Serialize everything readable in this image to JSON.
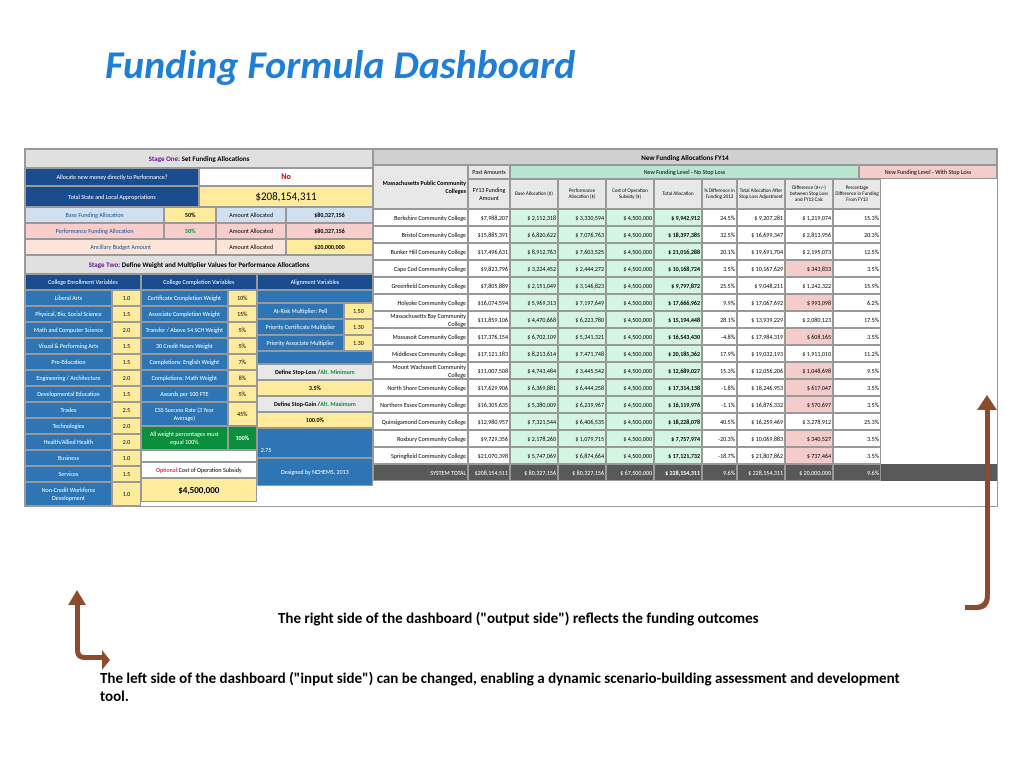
{
  "title": "Funding Formula Dashboard",
  "stage1_label": "Stage One:",
  "stage1_text": " Set Funding Allocations",
  "allocate_label": "Allocate new money directly to Performance?",
  "allocate_val": "No",
  "total_approp_label": "Total State and Local Appropriations",
  "total_approp_val": "$208,154,311",
  "base_fund_label": "Base Funding Allocation",
  "base_fund_pct": "50%",
  "amount_allocated_label": "Amount Allocated",
  "base_fund_amt": "$80,327,156",
  "perf_fund_label": "Performance Funding Allocation",
  "perf_fund_pct": "50%",
  "perf_fund_amt": "$80,327,156",
  "ancillary_label": "Ancillary Budget Amount",
  "ancillary_amt": "$20,000,000",
  "stage2_label": "Stage Two:",
  "stage2_text": " Define Weight and Multiplier Values for Performance Allocations",
  "col_enroll": "College Enrollment Variables",
  "col_complete": "College Completion Variables",
  "col_align": "Alignment Variables",
  "enroll_vars": [
    {
      "n": "Liberal Arts",
      "v": "1.0"
    },
    {
      "n": "Physical, Bio, Social Science",
      "v": "1.5"
    },
    {
      "n": "Math and Computer Science",
      "v": "2.0"
    },
    {
      "n": "Visual & Performing Arts",
      "v": "1.5"
    },
    {
      "n": "Pre-Education",
      "v": "1.5"
    },
    {
      "n": "Engineering / Architecture",
      "v": "2.0"
    },
    {
      "n": "Developmental Education",
      "v": "1.5"
    },
    {
      "n": "Trades",
      "v": "2.5"
    },
    {
      "n": "Technologies",
      "v": "2.0"
    },
    {
      "n": "Health/Allied Health",
      "v": "2.0"
    },
    {
      "n": "Business",
      "v": "1.0"
    },
    {
      "n": "Services",
      "v": "1.5"
    },
    {
      "n": "Non-Credit Workforce Development",
      "v": "1.0"
    }
  ],
  "complete_vars": [
    {
      "n": "Certificate Completion Weight",
      "v": "10%"
    },
    {
      "n": "Associate Completion Weight",
      "v": "15%"
    },
    {
      "n": "Transfer / Above 54 SCH Weight",
      "v": "5%"
    },
    {
      "n": "30 Credit Hours Weight",
      "v": "5%"
    },
    {
      "n": "Completions: English Weight",
      "v": "7%"
    },
    {
      "n": "Completions: Math Weight",
      "v": "8%"
    },
    {
      "n": "Awards per 100 FTE",
      "v": "5%"
    },
    {
      "n": "CSS Success Rate (3 Year Average)",
      "v": "45%"
    }
  ],
  "weight_total_label": "All weight percentages must equal 100%",
  "weight_total_val": "100%",
  "align_vars": [
    {
      "n": "At-Risk Multiplier: Pell",
      "v": "1.50"
    },
    {
      "n": "Priority Certificate Multiplier",
      "v": "1.30"
    },
    {
      "n": "Priority Associate Multiplier",
      "v": "1.30"
    }
  ],
  "stop_loss_label": "Define Stop-Loss / ",
  "stop_loss_alt": "Alt. Minimum",
  "stop_loss_val": "3.5%",
  "stop_gain_label": "Define Stop-Gain / ",
  "stop_gain_alt": "Alt. Maximum",
  "stop_gain_val": "100.0%",
  "optional_label": "Optional: ",
  "optional_text": "Cost of Operation Subsidy",
  "subsidy_val": "$4,500,000",
  "attrib": "2.75",
  "designed": "Designed by NCHEMS, 2013",
  "right_title": "New Funding Allocations FY14",
  "mass_label": "Massachusetts Public Community Colleges",
  "past_label": "Past Amounts",
  "fy13_label": "FY13 Funding Amount",
  "nsl_header": "New Funding Level - No Stop Loss",
  "wsl_header": "New Funding Level - With Stop Loss",
  "nsl_cols": [
    "Base Allocation ($)",
    "Performance Allocation ($)",
    "Cost of Operation Subsidy ($)",
    "Total Allocation",
    "% Difference in Funding 2013"
  ],
  "wsl_cols": [
    "Total Allocation After Stop Loss Adjustment",
    "Difference ($+/-) between Stop Loss and FY13 Calc",
    "Percentage Difference in Funding From FY13"
  ],
  "colleges": [
    {
      "n": "Berkshire Community College",
      "fy13": "$7,988,207",
      "b": "$ 2,112,318",
      "p": "$ 3,330,594",
      "c": "$ 4,500,000",
      "t": "$ 9,942,912",
      "pd": "24.5%",
      "tsl": "$ 9,207,281",
      "dsl": "$ 1,219,074",
      "psl": "15.3%"
    },
    {
      "n": "Bristol Community College",
      "fy13": "$15,885,391",
      "b": "$ 6,820,622",
      "p": "$ 7,076,763",
      "c": "$ 4,500,000",
      "t": "$ 18,397,385",
      "pd": "32.5%",
      "tsl": "$ 16,699,347",
      "dsl": "$ 2,813,956",
      "psl": "20.3%"
    },
    {
      "n": "Bunker Hill Community College",
      "fy13": "$17,496,631",
      "b": "$ 8,912,763",
      "p": "$ 7,603,525",
      "c": "$ 4,500,000",
      "t": "$ 21,016,288",
      "pd": "20.1%",
      "tsl": "$ 19,691,704",
      "dsl": "$ 2,195,073",
      "psl": "12.5%"
    },
    {
      "n": "Cape Cod Community College",
      "fy13": "$9,823,796",
      "b": "$ 3,224,452",
      "p": "$ 2,444,272",
      "c": "$ 4,500,000",
      "t": "$ 10,168,724",
      "pd": "3.5%",
      "tsl": "$ 10,167,629",
      "dsl": "$ 343,833",
      "psl": "3.5%"
    },
    {
      "n": "Greenfield Community College",
      "fy13": "$7,805,889",
      "b": "$ 2,151,049",
      "p": "$ 3,146,823",
      "c": "$ 4,500,000",
      "t": "$ 9,797,872",
      "pd": "25.5%",
      "tsl": "$ 9,048,211",
      "dsl": "$ 1,242,322",
      "psl": "15.9%"
    },
    {
      "n": "Holyoke Community College",
      "fy13": "$16,074,594",
      "b": "$ 5,969,313",
      "p": "$ 7,197,649",
      "c": "$ 4,500,000",
      "t": "$ 17,666,962",
      "pd": "9.9%",
      "tsl": "$ 17,067,692",
      "dsl": "$ 993,098",
      "psl": "6.2%"
    },
    {
      "n": "Massachusetts Bay Community College",
      "fy13": "$11,859,106",
      "b": "$ 4,470,668",
      "p": "$ 6,223,780",
      "c": "$ 4,500,000",
      "t": "$ 15,194,448",
      "pd": "28.1%",
      "tsl": "$ 13,939,229",
      "dsl": "$ 2,080,123",
      "psl": "17.5%"
    },
    {
      "n": "Massasoit Community College",
      "fy13": "$17,376,154",
      "b": "$ 6,702,109",
      "p": "$ 5,341,321",
      "c": "$ 4,500,000",
      "t": "$ 16,543,430",
      "pd": "-4.8%",
      "tsl": "$ 17,984,319",
      "dsl": "$ 608,165",
      "psl": "3.5%"
    },
    {
      "n": "Middlesex Community College",
      "fy13": "$17,121,183",
      "b": "$ 8,213,614",
      "p": "$ 7,471,748",
      "c": "$ 4,500,000",
      "t": "$ 20,185,362",
      "pd": "17.9%",
      "tsl": "$ 19,032,193",
      "dsl": "$ 1,911,010",
      "psl": "11.2%"
    },
    {
      "n": "Mount Wachusett Community College",
      "fy13": "$11,007,508",
      "b": "$ 4,743,484",
      "p": "$ 3,445,542",
      "c": "$ 4,500,000",
      "t": "$ 12,689,027",
      "pd": "15.3%",
      "tsl": "$ 12,056,206",
      "dsl": "$ 1,048,698",
      "psl": "9.5%"
    },
    {
      "n": "North Shore Community College",
      "fy13": "$17,629,906",
      "b": "$ 6,369,881",
      "p": "$ 6,444,258",
      "c": "$ 4,500,000",
      "t": "$ 17,314,138",
      "pd": "-1.8%",
      "tsl": "$ 18,246,953",
      "dsl": "$ 617,047",
      "psl": "3.5%"
    },
    {
      "n": "Northern Essex Community College",
      "fy13": "$16,305,635",
      "b": "$ 5,380,009",
      "p": "$ 6,239,967",
      "c": "$ 4,500,000",
      "t": "$ 16,119,976",
      "pd": "-1.1%",
      "tsl": "$ 16,876,332",
      "dsl": "$ 570,697",
      "psl": "3.5%"
    },
    {
      "n": "Quinsigamond Community College",
      "fy13": "$12,980,957",
      "b": "$ 7,321,544",
      "p": "$ 6,406,535",
      "c": "$ 4,500,000",
      "t": "$ 18,228,078",
      "pd": "40.5%",
      "tsl": "$ 16,259,469",
      "dsl": "$ 3,278,912",
      "psl": "25.3%"
    },
    {
      "n": "Roxbury Community College",
      "fy13": "$9,729,356",
      "b": "$ 2,178,260",
      "p": "$ 1,079,715",
      "c": "$ 4,500,000",
      "t": "$ 7,757,974",
      "pd": "-20.3%",
      "tsl": "$ 10,069,883",
      "dsl": "$ 340,527",
      "psl": "3.5%"
    },
    {
      "n": "Springfield Community College",
      "fy13": "$21,070,398",
      "b": "$ 5,747,069",
      "p": "$ 6,874,664",
      "c": "$ 4,500,000",
      "t": "$ 17,121,732",
      "pd": "-18.7%",
      "tsl": "$ 21,807,862",
      "dsl": "$ 737,464",
      "psl": "3.5%"
    }
  ],
  "totals": {
    "n": "SYSTEM TOTAL",
    "fy13": "$208,154,511",
    "b": "$ 80,327,156",
    "p": "$ 80,327,156",
    "c": "$ 67,500,000",
    "t": "$ 228,154,311",
    "pd": "9.6%",
    "tsl": "$ 228,154,311",
    "dsl": "$ 20,000,000",
    "psl": "9.6%"
  },
  "callout_right": "The right side of the dashboard (\"output side\") reflects the funding outcomes",
  "callout_left": "The left side of the dashboard (\"input side\") can be changed, enabling a dynamic scenario-building assessment and development tool."
}
